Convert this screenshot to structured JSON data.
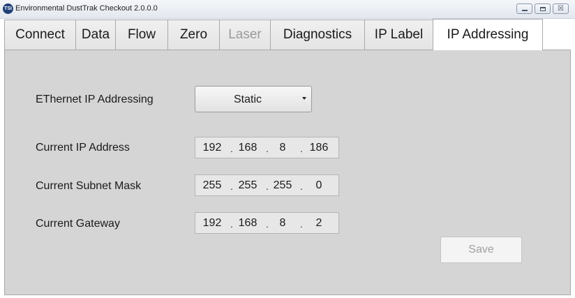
{
  "window": {
    "title": "Environmental DustTrak Checkout   2.0.0.0",
    "icon_text": "TSI",
    "controls": [
      "minimize-icon",
      "maximize-icon",
      "close-icon"
    ],
    "close_glyph": "☒"
  },
  "tabs": [
    {
      "label": "Connect",
      "state": "normal"
    },
    {
      "label": "Data",
      "state": "normal"
    },
    {
      "label": "Flow",
      "state": "normal"
    },
    {
      "label": "Zero",
      "state": "normal"
    },
    {
      "label": "Laser",
      "state": "disabled"
    },
    {
      "label": "Diagnostics",
      "state": "normal"
    },
    {
      "label": "IP Label",
      "state": "normal"
    },
    {
      "label": "IP Addressing",
      "state": "selected"
    }
  ],
  "form": {
    "addressing_label": "EThernet IP Addressing",
    "addressing_mode": "Static",
    "ip_label": "Current IP Address",
    "ip": [
      "192",
      "168",
      "8",
      "186"
    ],
    "subnet_label": "Current Subnet Mask",
    "subnet": [
      "255",
      "255",
      "255",
      "0"
    ],
    "gateway_label": "Current Gateway",
    "gateway": [
      "192",
      "168",
      "8",
      "2"
    ],
    "separator": "."
  },
  "save_label": "Save",
  "colors": {
    "panel_bg": "#d5d5d5",
    "tab_border": "#a9a9a9",
    "disabled_text": "#9a9a9a"
  }
}
